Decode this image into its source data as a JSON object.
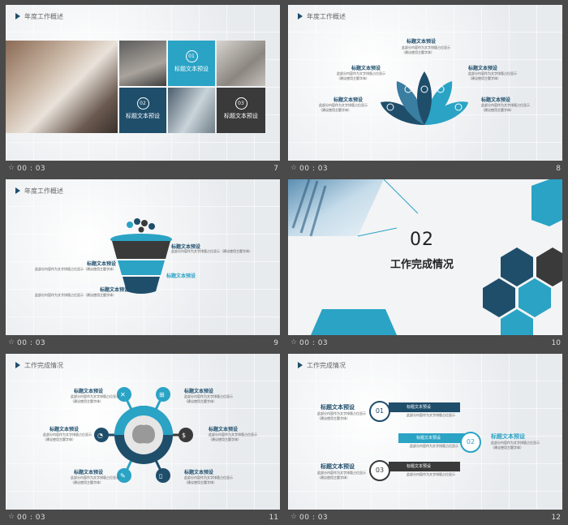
{
  "slides": [
    {
      "number": "7",
      "time": "00 : 03",
      "title": "年度工作概述",
      "tiles": [
        {
          "num": "01",
          "label": "标题文本预设"
        },
        {
          "num": "02",
          "label": "标题文本预设"
        },
        {
          "num": "03",
          "label": "标题文本预设"
        }
      ]
    },
    {
      "number": "8",
      "time": "00 : 03",
      "title": "年度工作概述",
      "top_label": "标题文本预设",
      "labels": [
        "标题文本预设",
        "标题文本预设",
        "标题文本预设",
        "标题文本预设"
      ],
      "desc": "此部分内容作为文字排版占位显示",
      "note": "（建议使用主题字体）"
    },
    {
      "number": "9",
      "time": "00 : 03",
      "title": "年度工作概述",
      "labels": [
        "标题文本预设",
        "标题文本预设",
        "标题文本预设",
        "标题文本预设"
      ],
      "desc": "此部分内容作为文字排版占位显示（建议使用主题字体）"
    },
    {
      "number": "10",
      "time": "00 : 03",
      "section_num": "02",
      "section_title": "工作完成情况"
    },
    {
      "number": "11",
      "time": "00 : 03",
      "title": "工作完成情况",
      "labels": [
        "标题文本预设",
        "标题文本预设",
        "标题文本预设",
        "标题文本预设",
        "标题文本预设",
        "标题文本预设"
      ],
      "desc": "此部分内容作为文字排版占位显示",
      "note": "（建议使用主题字体）"
    },
    {
      "number": "12",
      "time": "00 : 03",
      "title": "工作完成情况",
      "items": [
        {
          "num": "01",
          "label": "标题文本预设",
          "banner": "标题文本预设"
        },
        {
          "num": "02",
          "label": "标题文本预设",
          "banner": "标题文本预设"
        },
        {
          "num": "03",
          "label": "标题文本预设",
          "banner": "标题文本预设"
        }
      ],
      "desc": "此部分内容作为文字排版占位显示",
      "note": "（建议使用主题字体）"
    }
  ],
  "colors": {
    "dark": "#1f4e6b",
    "teal": "#2aa3c5",
    "grey": "#3a3a3a"
  }
}
